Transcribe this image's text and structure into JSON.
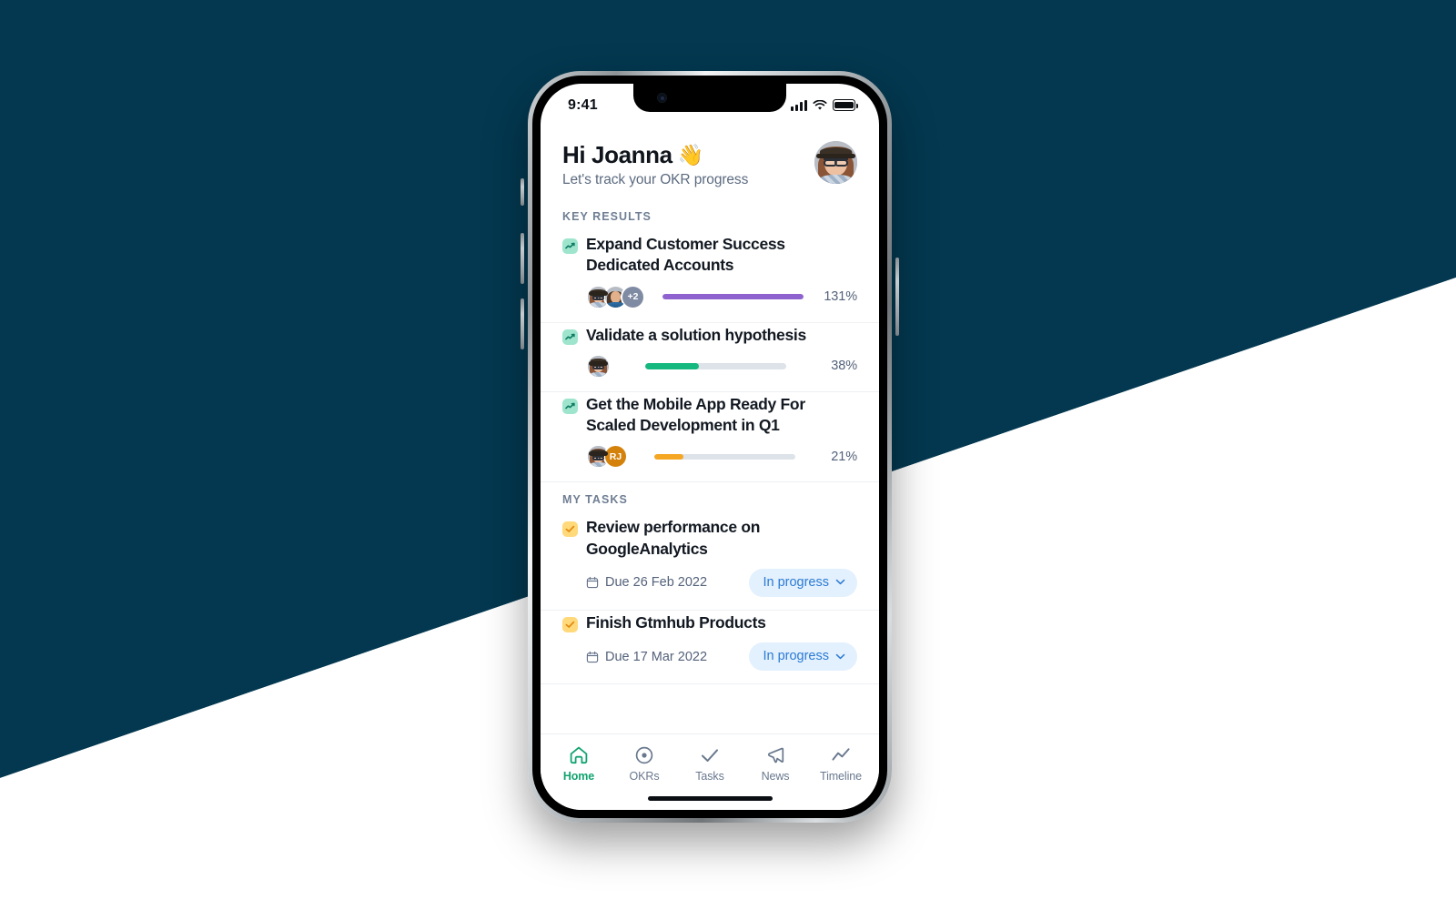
{
  "background": {
    "navy_color": "#033850",
    "white_color": "#ffffff"
  },
  "status_bar": {
    "time": "9:41",
    "signal_icon": "cellular-signal-icon",
    "wifi_icon": "wifi-icon",
    "battery_icon": "battery-icon"
  },
  "header": {
    "greeting": "Hi Joanna",
    "wave_emoji": "👋",
    "subtitle": "Let's track your OKR progress",
    "avatar_name": "user-avatar"
  },
  "sections": {
    "key_results_label": "KEY RESULTS",
    "my_tasks_label": "MY TASKS"
  },
  "key_results": [
    {
      "title": "Expand Customer Success Dedicated Accounts",
      "percent_label": "131%",
      "percent_value": 100,
      "bar_color": "#8e63cf",
      "avatars": [
        {
          "type": "photo",
          "variant": "f1"
        },
        {
          "type": "photo",
          "variant": "m1"
        },
        {
          "type": "more",
          "label": "+2"
        }
      ]
    },
    {
      "title": "Validate a solution hypothesis",
      "percent_label": "38%",
      "percent_value": 38,
      "bar_color": "#15b97f",
      "avatars": [
        {
          "type": "photo",
          "variant": "f1"
        }
      ]
    },
    {
      "title": "Get the Mobile App Ready For Scaled Development in Q1",
      "percent_label": "21%",
      "percent_value": 21,
      "bar_color": "#f5a623",
      "avatars": [
        {
          "type": "photo",
          "variant": "f1"
        },
        {
          "type": "initials",
          "label": "RJ",
          "color": "#d4820c"
        }
      ]
    }
  ],
  "tasks": [
    {
      "title": "Review performance on GoogleAnalytics",
      "due": "Due 26 Feb 2022",
      "status": "In progress",
      "calendar_icon": "calendar-icon",
      "chevron_icon": "chevron-down-icon"
    },
    {
      "title": "Finish Gtmhub Products",
      "due": "Due 17 Mar 2022",
      "status": "In progress",
      "calendar_icon": "calendar-icon",
      "chevron_icon": "chevron-down-icon"
    }
  ],
  "tabs": [
    {
      "label": "Home",
      "icon": "home-icon",
      "active": true
    },
    {
      "label": "OKRs",
      "icon": "target-icon",
      "active": false
    },
    {
      "label": "Tasks",
      "icon": "check-icon",
      "active": false
    },
    {
      "label": "News",
      "icon": "megaphone-icon",
      "active": false
    },
    {
      "label": "Timeline",
      "icon": "trend-line-icon",
      "active": false
    }
  ],
  "accent_colors": {
    "active_tab": "#12a370",
    "chip_text": "#2b7bd4",
    "chip_bg": "#e3f0fe",
    "kr_icon_bg": "#9fe5cd",
    "task_check_bg": "#ffd97a"
  }
}
